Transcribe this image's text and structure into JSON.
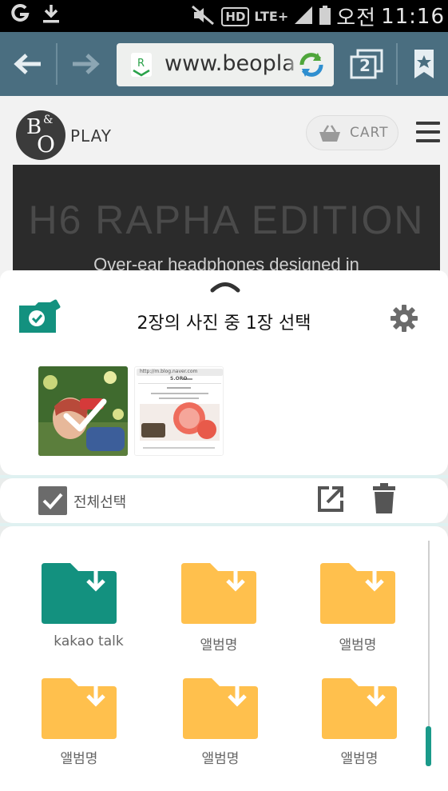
{
  "status_bar": {
    "network": "LTE+",
    "hd": "HD",
    "am_pm": "오전",
    "time": "11:16"
  },
  "browser": {
    "url": "www.beopla",
    "tab_count": "2"
  },
  "webpage": {
    "logo_top": "B",
    "logo_amp": "&",
    "logo_bottom": "O",
    "play": "PLAY",
    "cart": "CART",
    "hero_title": "H6 RAPHA EDITION",
    "hero_subtitle": "Over-ear headphones designed in"
  },
  "sheet": {
    "title": "2장의 사진 중 1장 선택",
    "select_all": "전체선택",
    "thumb2_url": "http://m.blog.naver.com",
    "thumb2_site": "S.ORO"
  },
  "folders": [
    {
      "label": "kakao talk",
      "color": "#13917f"
    },
    {
      "label": "앨범명",
      "color": "#ffc04d"
    },
    {
      "label": "앨범명",
      "color": "#ffc04d"
    },
    {
      "label": "앨범명",
      "color": "#ffc04d"
    },
    {
      "label": "앨범명",
      "color": "#ffc04d"
    },
    {
      "label": "앨범명",
      "color": "#ffc04d"
    }
  ],
  "colors": {
    "toolbar": "#4a6e80",
    "accent_teal": "#13917f",
    "folder_yellow": "#ffc04d"
  }
}
